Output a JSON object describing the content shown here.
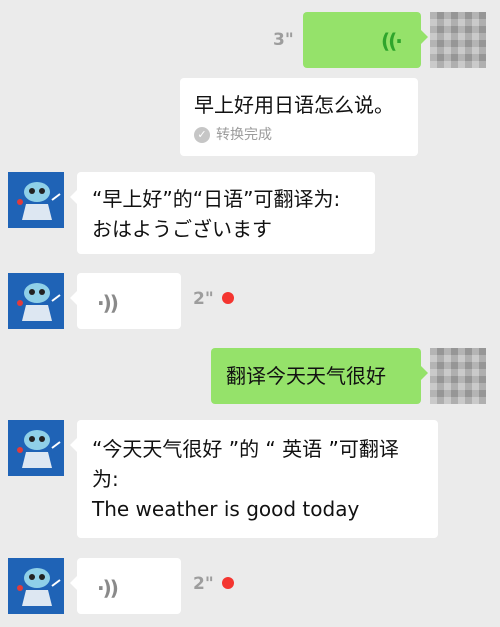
{
  "messages": [
    {
      "duration": "3\"",
      "icon": "voice-icon"
    },
    {
      "text": "早上好用日语怎么说。",
      "status": "转换完成",
      "status_icon": "check-circle-icon"
    },
    {
      "line1": "“早上好”的“日语”可翻译为:",
      "line2": "おはようございます"
    },
    {
      "duration": "2\"",
      "icon": "voice-icon"
    },
    {
      "text": "翻译今天天气很好"
    },
    {
      "line1": "“今天天气很好 ”的 “ 英语 ”可翻译",
      "line2": "为:",
      "line3": "The weather is good today"
    },
    {
      "duration": "2\"",
      "icon": "voice-icon"
    }
  ],
  "colors": {
    "background": "#ebebeb",
    "outgoing_bubble": "#95e26a",
    "incoming_bubble": "#ffffff",
    "unread_dot": "#f43530",
    "bot_avatar": "#1f63b6"
  }
}
